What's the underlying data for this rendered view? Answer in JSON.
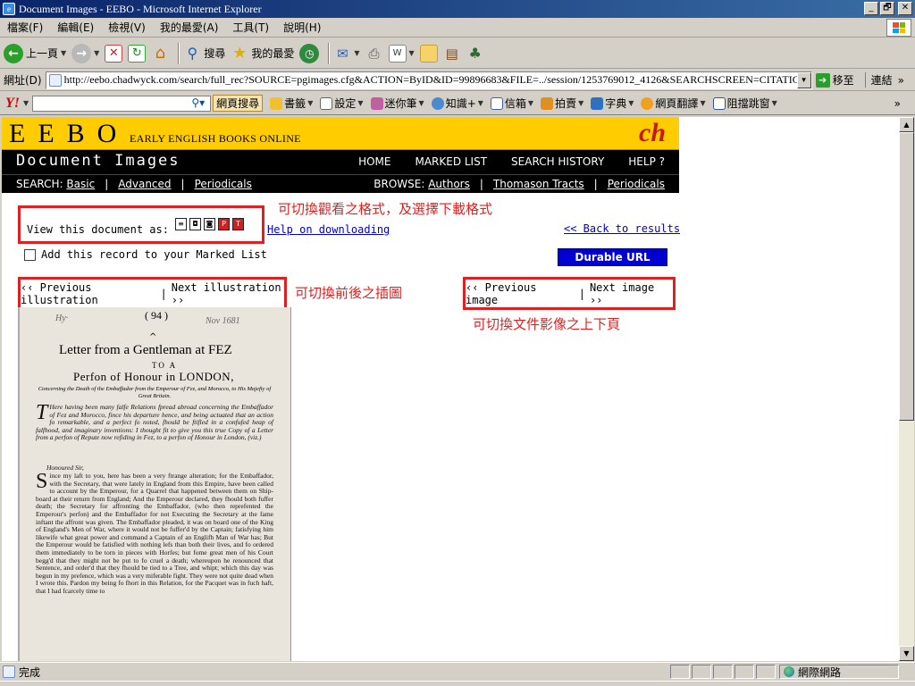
{
  "window": {
    "title": "Document Images - EEBO - Microsoft Internet Explorer",
    "min": "_",
    "max": "🗗",
    "close": "✕"
  },
  "menu": [
    "檔案(F)",
    "編輯(E)",
    "檢視(V)",
    "我的最愛(A)",
    "工具(T)",
    "說明(H)"
  ],
  "toolbar": {
    "back": "上一頁",
    "search": "搜尋",
    "favorites": "我的最愛"
  },
  "address": {
    "label": "網址(D)",
    "url": "http://eebo.chadwyck.com/search/full_rec?SOURCE=pgimages.cfg&ACTION=ByID&ID=99896683&FILE=../session/1253769012_4126&SEARCHSCREEN=CITATIONS&S",
    "go": "移至",
    "links": "連結",
    "more": "»"
  },
  "yahoo": {
    "logo": "Y!",
    "search_btn": "網頁搜尋",
    "items": [
      "書籤",
      "設定",
      "迷你筆",
      "知識+",
      "信箱",
      "拍賣",
      "字典",
      "網頁翻譯",
      "阻擋跳窗"
    ],
    "more": "»"
  },
  "eebo": {
    "logo": "EEBO",
    "subtitle": "EARLY ENGLISH BOOKS ONLINE",
    "mark": "ch",
    "page_title": "Document Images",
    "topnav": [
      "HOME",
      "MARKED LIST",
      "SEARCH HISTORY",
      "HELP ?"
    ],
    "search_label": "SEARCH:",
    "search_links": [
      "Basic",
      "Advanced",
      "Periodicals"
    ],
    "browse_label": "BROWSE:",
    "browse_links": [
      "Authors",
      "Thomason Tracts",
      "Periodicals"
    ]
  },
  "view": {
    "label": "View this document as:",
    "help": "Help on downloading",
    "back": "<< Back to results",
    "marked": "Add this record to your Marked List",
    "durable": "Durable URL"
  },
  "nav": {
    "prev_ill": "‹‹ Previous illustration",
    "next_ill": "Next illustration ››",
    "prev_img": "‹‹ Previous image",
    "next_img": "Next image ››",
    "sep": "|"
  },
  "annotations": {
    "format": "可切換觀看之格式，及選擇下載格式",
    "illustration": "可切換前後之插圖",
    "image": "可切換文件影像之上下頁"
  },
  "scan": {
    "page_number": "( 94 )",
    "scrawl_left": "Hy·",
    "scrawl_right": "Nov 1681",
    "title": "Letter from a Gentleman at FEZ",
    "to_a": "TO A",
    "subtitle": "Perfon of Honour in  LONDON,",
    "concerning": "Concerning the Death of the Embaffador from the Emperour of Fez, and Morocco, to His Majefty of Great Britain.",
    "para1": "Here having been many falfe Relations fpread abroad concerning the Embaffador of Fez and Morocco, fince his departure hence, and being actuated that an action fo remarkable, and a perfect fo noted, fhould be ftifled in a confufed heap of falfhood, and imaginary inventions: I thought fit to give you this true Copy of a Letter from a perfon of Repute now refiding in Fez, to a perfon of Honour in London, (viz.)",
    "salutation": "Honoured Sir,",
    "para2": "ince my laft to you, here has been a very ftrange alteration; for the Embaffador, with the Secretary, that were lately in England from this Empire, have been called to account by the Emperour, for a Quarrel that happened between them on Ship-board at their return from England; And the Emperour declared, they fhould both fuffer death; the Secretary for affronting the Embaffador, (who then reprefented the Emperour's perfon) and the Embaffador for not Executing the Secretary at the fame inftant the affront was given. The Embaffador pleaded, it was on board one of the King of England's Men of War, where it would not be fuffer'd by the Captain; fatisfying him likewife what great power and command a Captain of an Englifh Man of War has; But the Emperour would be fatisfied with nothing lefs than both their lives, and fo ordered them immediately to be torn in pieces with Horfes; but fome great men of his Court begg'd that they might not be put to fo cruel a death; whereupon he renounced that Sentence, and order'd that they fhould be tied to a Tree, and whipt; which this day was begun in my prefence, which was a very miferable fight. They were not quite dead when I wrote this. Pardon my being fo fhort in this Relation, for the Pacquet was in fuch haft, that I had fcarcely time to"
  },
  "status": {
    "done": "完成",
    "zone": "網際網路"
  }
}
